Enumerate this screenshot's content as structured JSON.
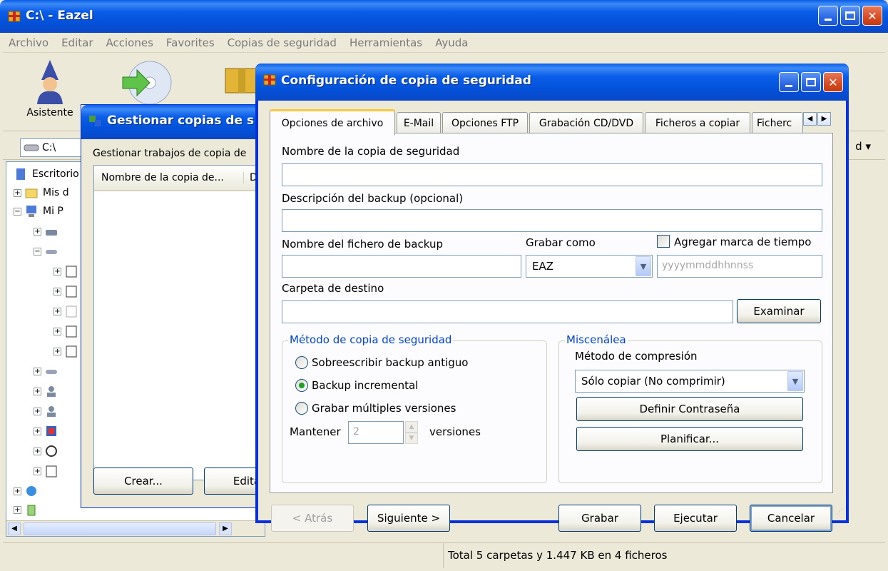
{
  "main_window": {
    "title": "C:\\ - Eazel",
    "menu": [
      "Archivo",
      "Editar",
      "Acciones",
      "Favorites",
      "Copias de seguridad",
      "Herramientas",
      "Ayuda"
    ],
    "toolbar": {
      "wizard_label": "Asistente"
    },
    "address": {
      "path": "C:\\",
      "right_label": "d"
    },
    "tree": [
      {
        "label": "Escritorio",
        "level": 0
      },
      {
        "label": "Mis d",
        "level": 1
      },
      {
        "label": "Mi P",
        "level": 1
      }
    ],
    "status": "Total 5 carpetas y 1.447 KB en 4 ficheros"
  },
  "manage_window": {
    "title": "Gestionar copias de s",
    "caption": "Gestionar trabajos de copia de",
    "column_name": "Nombre de la copia de...",
    "column_second": "D",
    "create_button": "Crear...",
    "edit_button": "Edita"
  },
  "config_dialog": {
    "title": "Configuración de copia de seguridad",
    "tabs": [
      "Opciones de archivo",
      "E-Mail",
      "Opciones FTP",
      "Grabación CD/DVD",
      "Ficheros a copiar",
      "Ficherc"
    ],
    "fields": {
      "backup_name_label": "Nombre de la copia de seguridad",
      "backup_name_value": "",
      "description_label": "Descripción del backup (opcional)",
      "description_value": "",
      "filename_label": "Nombre del fichero de backup",
      "filename_value": "",
      "save_as_label": "Grabar como",
      "save_as_value": "EAZ",
      "timestamp_label": "Agregar marca de tiempo",
      "timestamp_placeholder": "yyyymmddhhnnss",
      "destination_label": "Carpeta de destino",
      "destination_value": "",
      "browse_button": "Examinar"
    },
    "method_group": {
      "title": "Método de copia de seguridad",
      "options": [
        "Sobreescribir backup antiguo",
        "Backup incremental",
        "Grabar múltiples versiones"
      ],
      "selected_index": 1,
      "keep_label": "Mantener",
      "keep_value": "2",
      "versions_label": "versiones"
    },
    "misc_group": {
      "title": "Miscenálea",
      "compression_label": "Método de compresión",
      "compression_value": "Sólo copiar (No comprimir)",
      "password_button": "Definir Contraseña",
      "schedule_button": "Planificar..."
    },
    "footer": {
      "back_button": "< Atrás",
      "next_button": "Siguiente >",
      "save_button": "Grabar",
      "run_button": "Ejecutar",
      "cancel_button": "Cancelar"
    }
  }
}
